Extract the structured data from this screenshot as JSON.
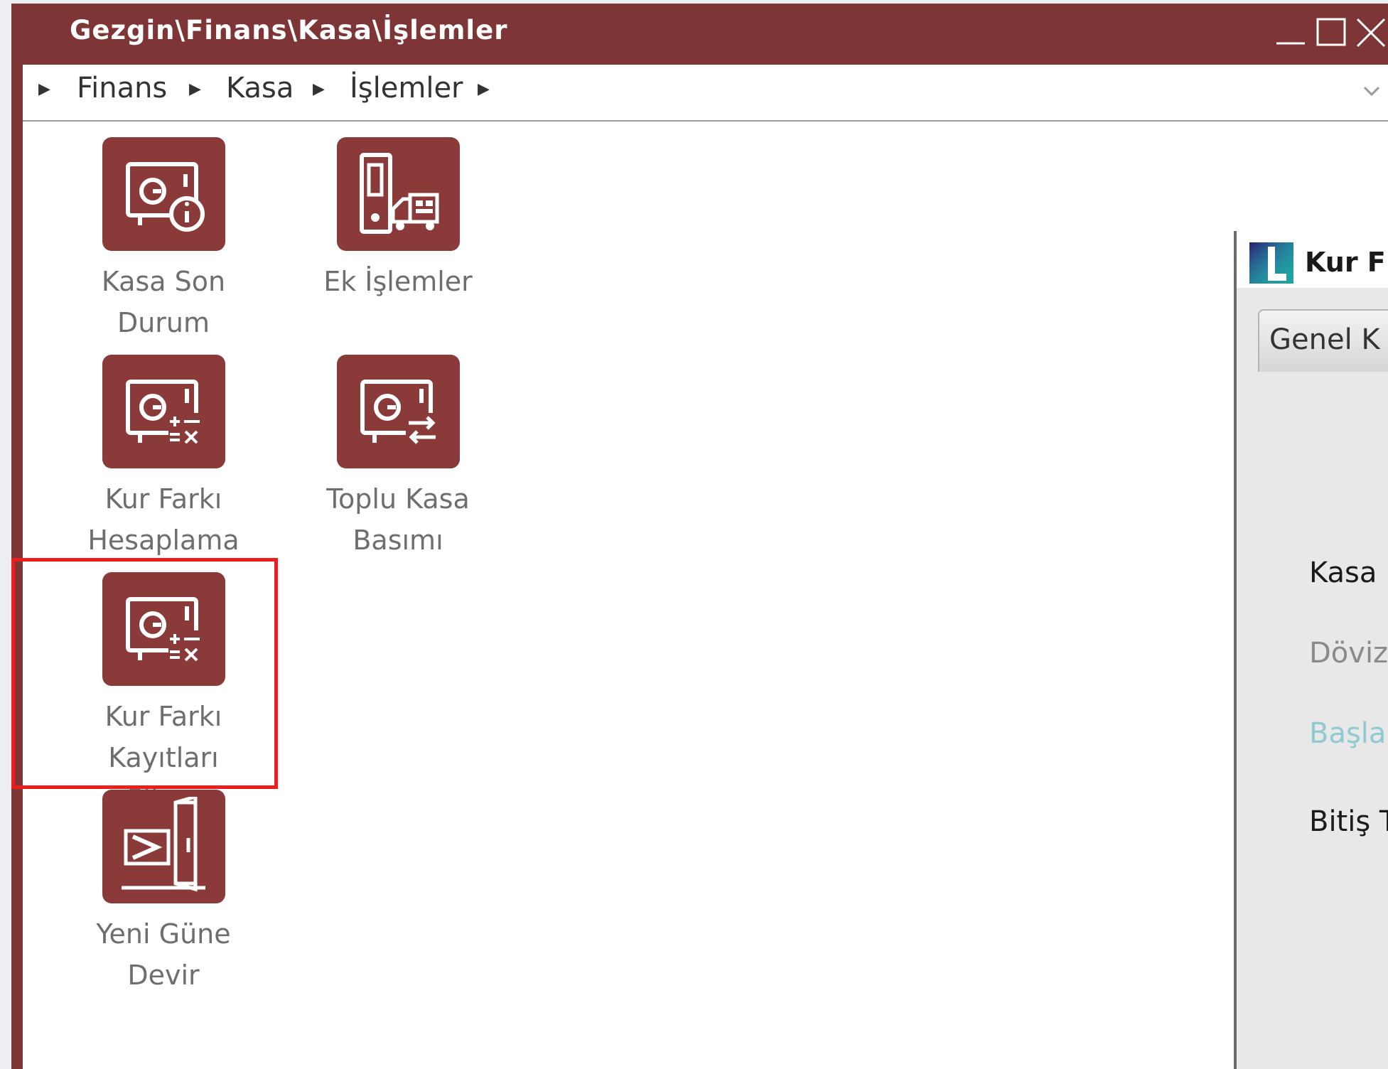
{
  "window": {
    "title": "Gezgin\\Finans\\Kasa\\İşlemler",
    "controls": {
      "minimize": "_",
      "maximize": "□",
      "close": "✕"
    }
  },
  "breadcrumb": {
    "items": [
      "Finans",
      "Kasa",
      "İşlemler"
    ],
    "arrow": "▶"
  },
  "tiles": [
    {
      "label": "Kasa Son\nDurum",
      "icon": "safe-info-icon"
    },
    {
      "label": "Ek İşlemler",
      "icon": "ledger-truck-icon"
    },
    {
      "label": "Kur Farkı\nHesaplama",
      "icon": "safe-calc-icon"
    },
    {
      "label": "Toplu Kasa\nBasımı",
      "icon": "safe-transfer-icon"
    },
    {
      "label": "Kur Farkı\nKayıtları Silme",
      "icon": "safe-calc-icon"
    },
    {
      "label": "Yeni Güne\nDevir",
      "icon": "door-enter-icon"
    }
  ],
  "dialog": {
    "title": "Kur F",
    "tab": "Genel K",
    "fields": [
      {
        "label": "Kasa",
        "color": "#1a1a1a"
      },
      {
        "label": "Döviz",
        "color": "#8a8a8a"
      },
      {
        "label": "Başla",
        "color": "#8fc9d1"
      },
      {
        "label": "Bitiş T",
        "color": "#1a1a1a"
      }
    ]
  },
  "colors": {
    "titlebar": "#7d3535",
    "tile_icon_bg": "#8b3a3a",
    "highlight_border": "#ee1c1c"
  }
}
